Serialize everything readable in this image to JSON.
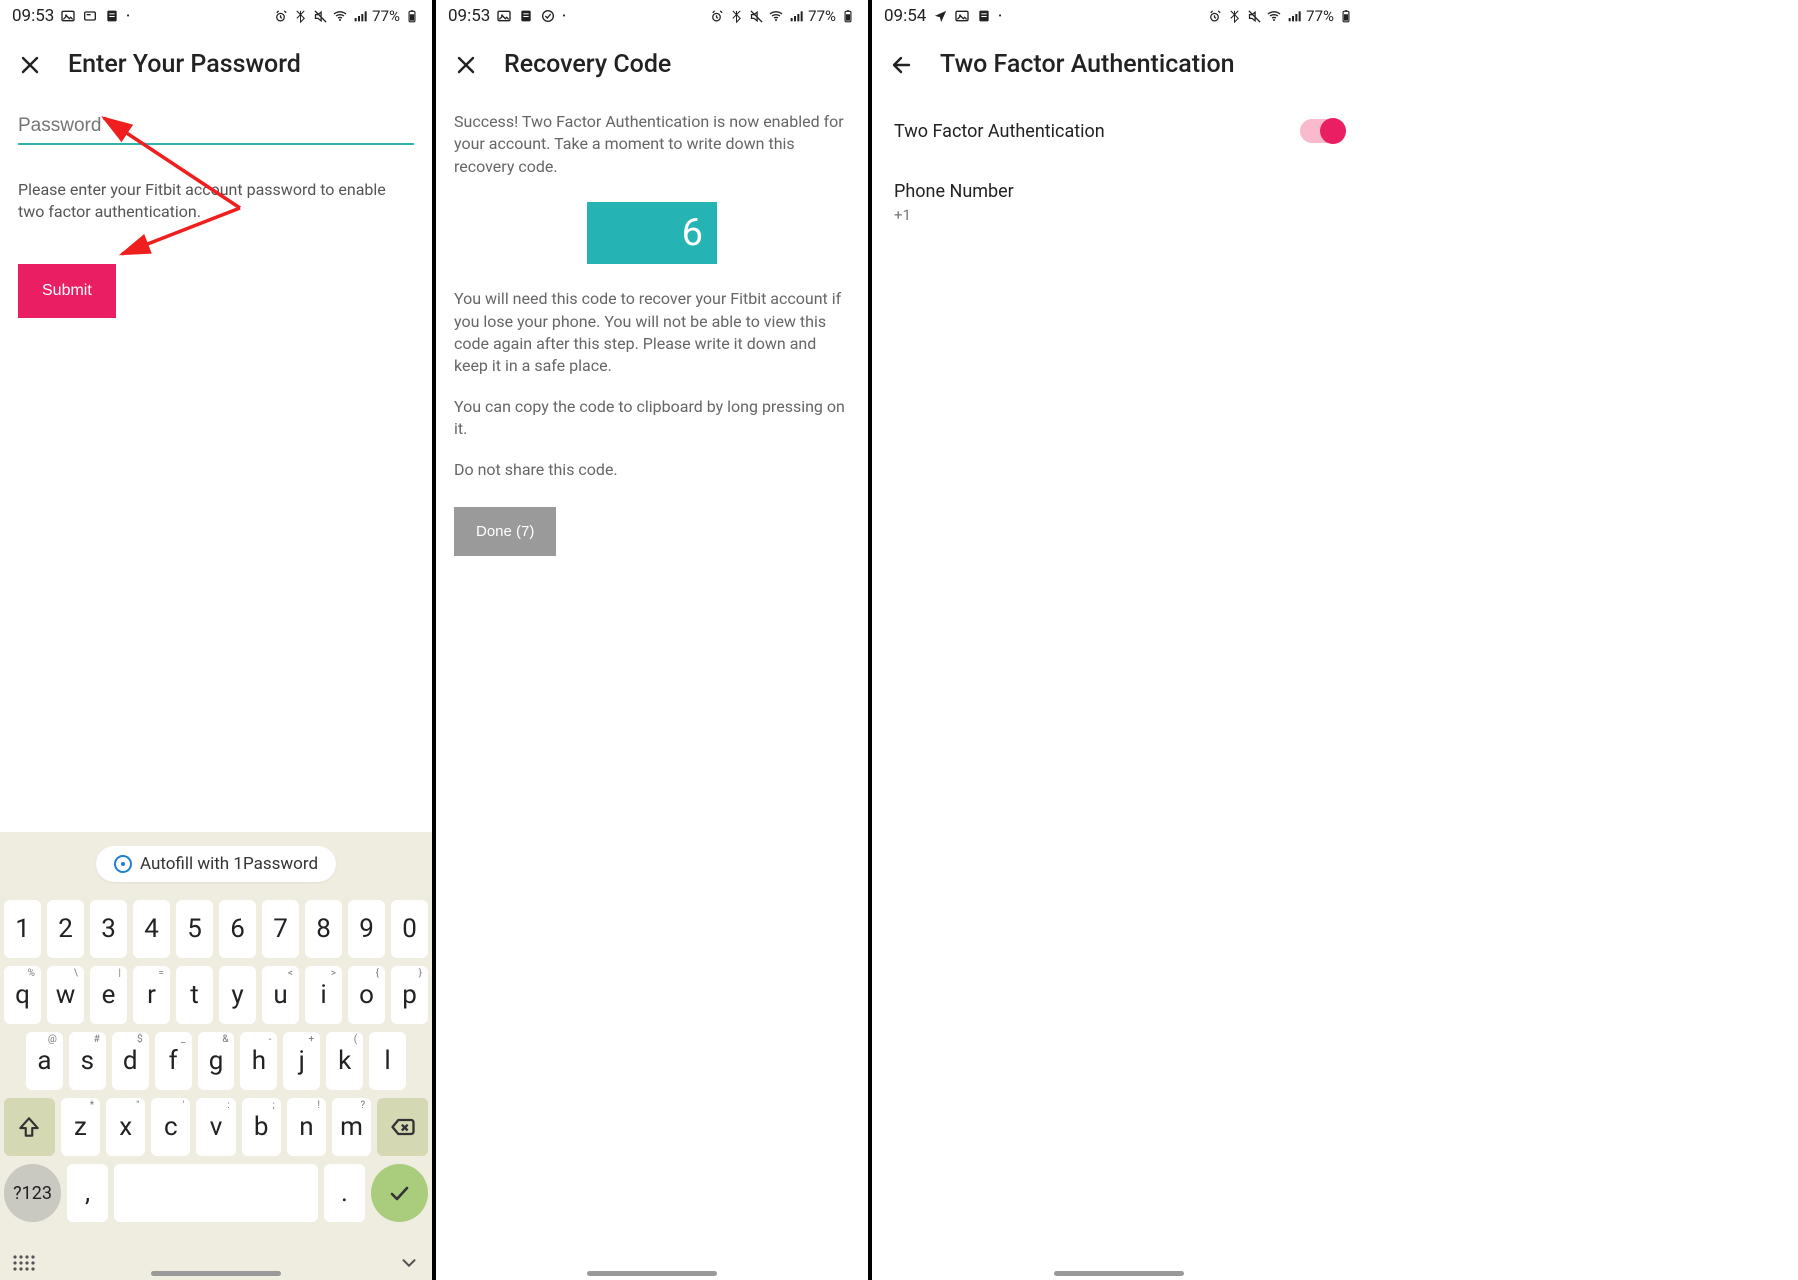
{
  "status": {
    "time1": "09:53",
    "time2": "09:53",
    "time3": "09:54",
    "battery": "77%"
  },
  "screen1": {
    "title": "Enter Your Password",
    "password_placeholder": "Password",
    "help_text": "Please enter your Fitbit account password to enable two factor authentication.",
    "submit_label": "Submit",
    "autofill_label": "Autofill with 1Password"
  },
  "keyboard": {
    "row_num": [
      "1",
      "2",
      "3",
      "4",
      "5",
      "6",
      "7",
      "8",
      "9",
      "0"
    ],
    "row_q": [
      "q",
      "w",
      "e",
      "r",
      "t",
      "y",
      "u",
      "i",
      "o",
      "p"
    ],
    "row_q_hints": [
      "%",
      "\\",
      "|",
      "=",
      "",
      "",
      "<",
      ">",
      "{",
      "}"
    ],
    "row_a": [
      "a",
      "s",
      "d",
      "f",
      "g",
      "h",
      "j",
      "k",
      "l"
    ],
    "row_a_hints": [
      "@",
      "#",
      "$",
      "_",
      "&",
      "-",
      "+",
      "(",
      ""
    ],
    "row_z": [
      "z",
      "x",
      "c",
      "v",
      "b",
      "n",
      "m"
    ],
    "row_z_hints": [
      "*",
      "\"",
      "'",
      ":",
      ";",
      "!",
      "?"
    ],
    "sym": "?123",
    "comma": ",",
    "dot": "."
  },
  "screen2": {
    "title": "Recovery Code",
    "intro": "Success! Two Factor Authentication is now enabled for your account. Take a moment to write down this recovery code.",
    "code_visible": "6",
    "warn": "You will need this code to recover your Fitbit account if you lose your phone. You will not be able to view this code again after this step. Please write it down and keep it in a safe place.",
    "copy_hint": "You can copy the code to clipboard by long pressing on it.",
    "noshare": "Do not share this code.",
    "done_label": "Done (7)"
  },
  "screen3": {
    "title": "Two Factor Authentication",
    "toggle_label": "Two Factor Authentication",
    "phone_label": "Phone Number",
    "phone_value": "+1"
  }
}
